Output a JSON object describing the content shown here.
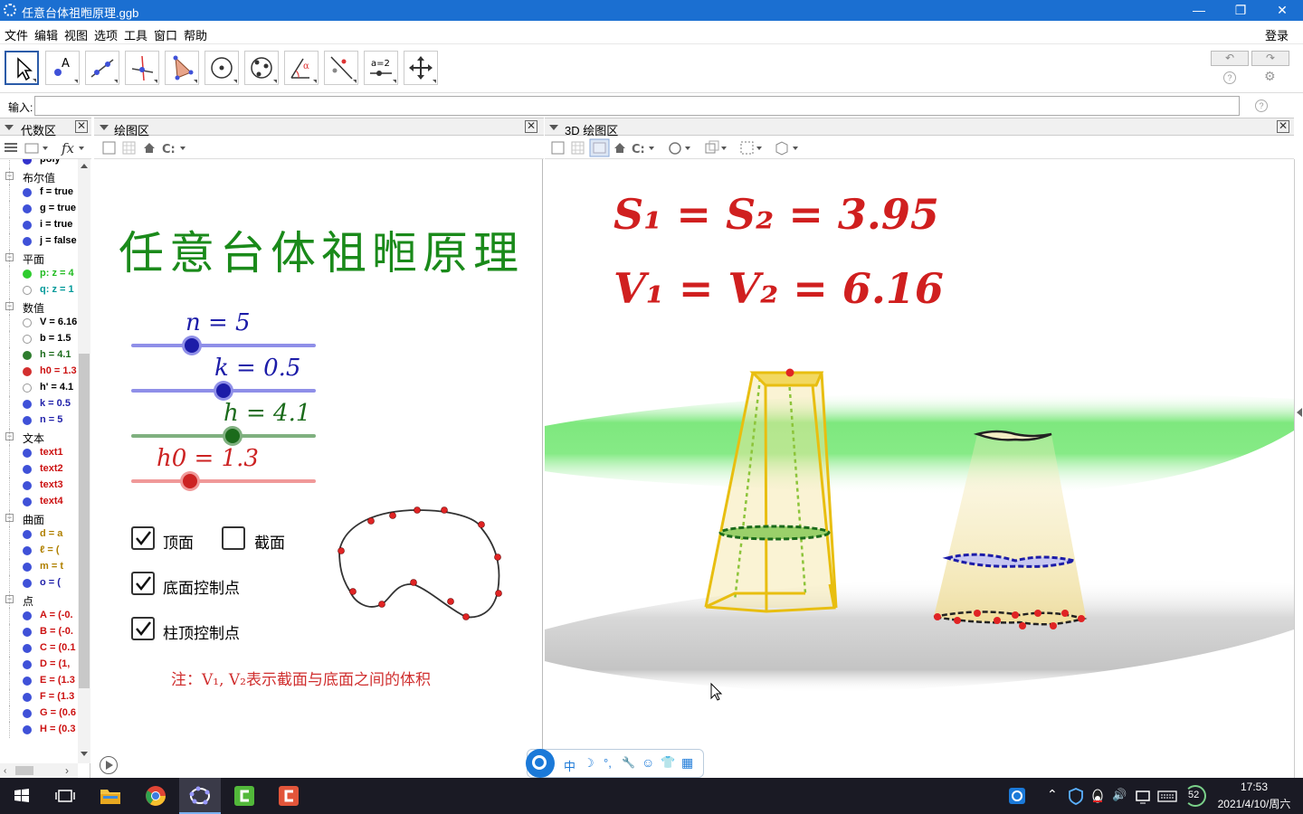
{
  "window": {
    "title": "任意台体祖暅原理.ggb",
    "minimize": "—",
    "maximize": "❐",
    "close": "✕"
  },
  "menu": {
    "items": [
      "文件",
      "编辑",
      "视图",
      "选项",
      "工具",
      "窗口",
      "帮助"
    ],
    "login": "登录"
  },
  "toolbar": {
    "tools": [
      "move-tool",
      "point-tool",
      "line-tool",
      "perpendicular-tool",
      "polygon-tool",
      "circle-tool",
      "conic-tool",
      "angle-tool",
      "reflect-tool",
      "slider-tool",
      "move-view-tool"
    ],
    "slider_tool_text": "a=2",
    "undo": "↶",
    "redo": "↷"
  },
  "input": {
    "label": "输入:",
    "value": ""
  },
  "panels": {
    "algebra": "代数区",
    "graphics": "绘图区",
    "graphics3d": "3D 绘图区"
  },
  "algebra": {
    "rows": [
      {
        "type": "item",
        "text": "poly",
        "color": "#3333cc",
        "filled": true
      },
      {
        "type": "group",
        "text": "布尔值"
      },
      {
        "type": "item",
        "text": "f = true",
        "color": "#3f51d8",
        "filled": true,
        "textcolor": "#000000"
      },
      {
        "type": "item",
        "text": "g = true",
        "color": "#3f51d8",
        "filled": true,
        "textcolor": "#000000"
      },
      {
        "type": "item",
        "text": "i = true",
        "color": "#3f51d8",
        "filled": true,
        "textcolor": "#000000"
      },
      {
        "type": "item",
        "text": "j = false",
        "color": "#3f51d8",
        "filled": true,
        "textcolor": "#000000"
      },
      {
        "type": "group",
        "text": "平面"
      },
      {
        "type": "item",
        "text": "p: z = 4",
        "color": "#2ecc2e",
        "filled": true,
        "textcolor": "#22bb22"
      },
      {
        "type": "item",
        "text": "q: z = 1",
        "color": "#888888",
        "filled": false,
        "textcolor": "#009999"
      },
      {
        "type": "group",
        "text": "数值"
      },
      {
        "type": "item",
        "text": "V = 6.16",
        "color": "#888888",
        "filled": false,
        "textcolor": "#000000"
      },
      {
        "type": "item",
        "text": "b = 1.5",
        "color": "#888888",
        "filled": false,
        "textcolor": "#000000"
      },
      {
        "type": "item",
        "text": "h = 4.1",
        "color": "#2e7d2e",
        "filled": true,
        "textcolor": "#1b6b1b"
      },
      {
        "type": "item",
        "text": "h0 = 1.3",
        "color": "#d32f2f",
        "filled": true,
        "textcolor": "#cc1111"
      },
      {
        "type": "item",
        "text": "h' = 4.1",
        "color": "#888888",
        "filled": false,
        "textcolor": "#000000"
      },
      {
        "type": "item",
        "text": "k = 0.5",
        "color": "#3f51d8",
        "filled": true,
        "textcolor": "#2222aa"
      },
      {
        "type": "item",
        "text": "n = 5",
        "color": "#3f51d8",
        "filled": true,
        "textcolor": "#2222aa"
      },
      {
        "type": "group",
        "text": "文本"
      },
      {
        "type": "item",
        "text": "text1",
        "color": "#3f51d8",
        "filled": true,
        "textcolor": "#cc1111"
      },
      {
        "type": "item",
        "text": "text2",
        "color": "#3f51d8",
        "filled": true,
        "textcolor": "#cc1111"
      },
      {
        "type": "item",
        "text": "text3",
        "color": "#3f51d8",
        "filled": true,
        "textcolor": "#cc1111"
      },
      {
        "type": "item",
        "text": "text4",
        "color": "#3f51d8",
        "filled": true,
        "textcolor": "#cc1111"
      },
      {
        "type": "group",
        "text": "曲面"
      },
      {
        "type": "item",
        "text": "d = a",
        "color": "#3f51d8",
        "filled": true,
        "textcolor": "#b08000"
      },
      {
        "type": "item",
        "text": "ℓ = (",
        "color": "#3f51d8",
        "filled": true,
        "textcolor": "#b08000"
      },
      {
        "type": "item",
        "text": "m = t",
        "color": "#3f51d8",
        "filled": true,
        "textcolor": "#b08000"
      },
      {
        "type": "item",
        "text": "o = (",
        "color": "#3f51d8",
        "filled": true,
        "textcolor": "#2222aa"
      },
      {
        "type": "group",
        "text": "点"
      },
      {
        "type": "item",
        "text": "A = (-0.",
        "color": "#3f51d8",
        "filled": true,
        "textcolor": "#cc1111"
      },
      {
        "type": "item",
        "text": "B = (-0.",
        "color": "#3f51d8",
        "filled": true,
        "textcolor": "#cc1111"
      },
      {
        "type": "item",
        "text": "C = (0.1",
        "color": "#3f51d8",
        "filled": true,
        "textcolor": "#cc1111"
      },
      {
        "type": "item",
        "text": "D = (1,",
        "color": "#3f51d8",
        "filled": true,
        "textcolor": "#cc1111"
      },
      {
        "type": "item",
        "text": "E = (1.3",
        "color": "#3f51d8",
        "filled": true,
        "textcolor": "#cc1111"
      },
      {
        "type": "item",
        "text": "F = (1.3",
        "color": "#3f51d8",
        "filled": true,
        "textcolor": "#cc1111"
      },
      {
        "type": "item",
        "text": "G = (0.6",
        "color": "#3f51d8",
        "filled": true,
        "textcolor": "#cc1111"
      },
      {
        "type": "item",
        "text": "H = (0.3",
        "color": "#3f51d8",
        "filled": true,
        "textcolor": "#cc1111"
      }
    ]
  },
  "graphics": {
    "title": "任意台体祖暅原理",
    "sliders": [
      {
        "label": "n = 5",
        "value": 0.33,
        "color": "#1c1ca8",
        "track": "#8f8fe8"
      },
      {
        "label": "k = 0.5",
        "value": 0.5,
        "color": "#1c1ca8",
        "track": "#8f8fe8"
      },
      {
        "label": "h = 4.1",
        "value": 0.55,
        "color": "#1b6b1b",
        "track": "#7fb07f"
      },
      {
        "label": "h0 = 1.3",
        "value": 0.32,
        "color": "#cc2222",
        "track": "#f09999"
      }
    ],
    "checkboxes": [
      {
        "label": "顶面",
        "checked": true
      },
      {
        "label": "截面",
        "checked": false
      },
      {
        "label": "底面控制点",
        "checked": true
      },
      {
        "label": "柱顶控制点",
        "checked": true
      }
    ],
    "note": "注：V₁, V₂表示截面与底面之间的体积"
  },
  "view3d": {
    "eq1": "S₁ = S₂ = 3.95",
    "eq2": "V₁ = V₂ = 6.16",
    "colors": {
      "plane": "#5ee05e",
      "floor": "#bdbdbd",
      "prism": "#f2c418",
      "text": "#cc1111"
    }
  },
  "ime": {
    "items": [
      "中",
      "☽",
      "°,",
      "🔧",
      "☺",
      "👕",
      "▦"
    ]
  },
  "taskbar": {
    "time": "17:53",
    "date": "2021/4/10/周六",
    "tray_num": "52"
  }
}
